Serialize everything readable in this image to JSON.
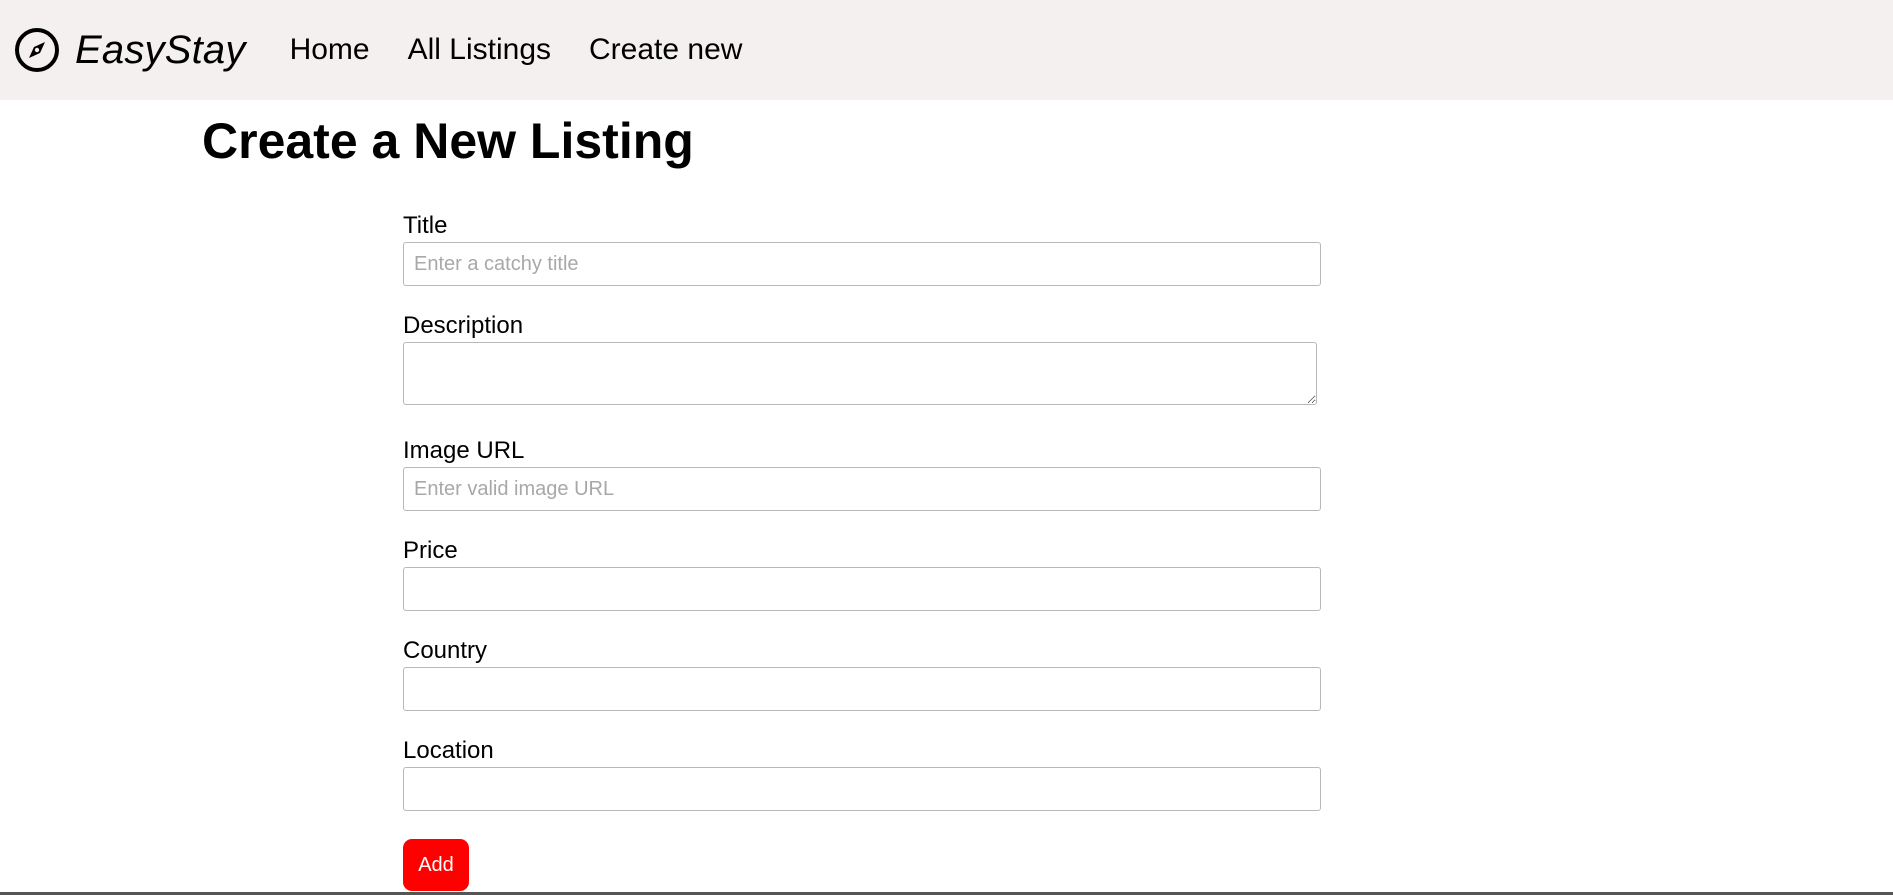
{
  "navbar": {
    "brand_icon": "compass-icon",
    "brand_name": "EasyStay",
    "links": [
      {
        "label": "Home"
      },
      {
        "label": "All Listings"
      },
      {
        "label": "Create new"
      }
    ],
    "background": "#f5f0f0"
  },
  "page": {
    "title": "Create a New Listing"
  },
  "form": {
    "title": {
      "label": "Title",
      "placeholder": "Enter a catchy title",
      "value": ""
    },
    "description": {
      "label": "Description",
      "value": ""
    },
    "image_url": {
      "label": "Image URL",
      "placeholder": "Enter valid image URL",
      "value": ""
    },
    "price": {
      "label": "Price",
      "value": ""
    },
    "country": {
      "label": "Country",
      "value": ""
    },
    "location": {
      "label": "Location",
      "value": ""
    },
    "submit_label": "Add",
    "submit_color": "#ff0000"
  }
}
